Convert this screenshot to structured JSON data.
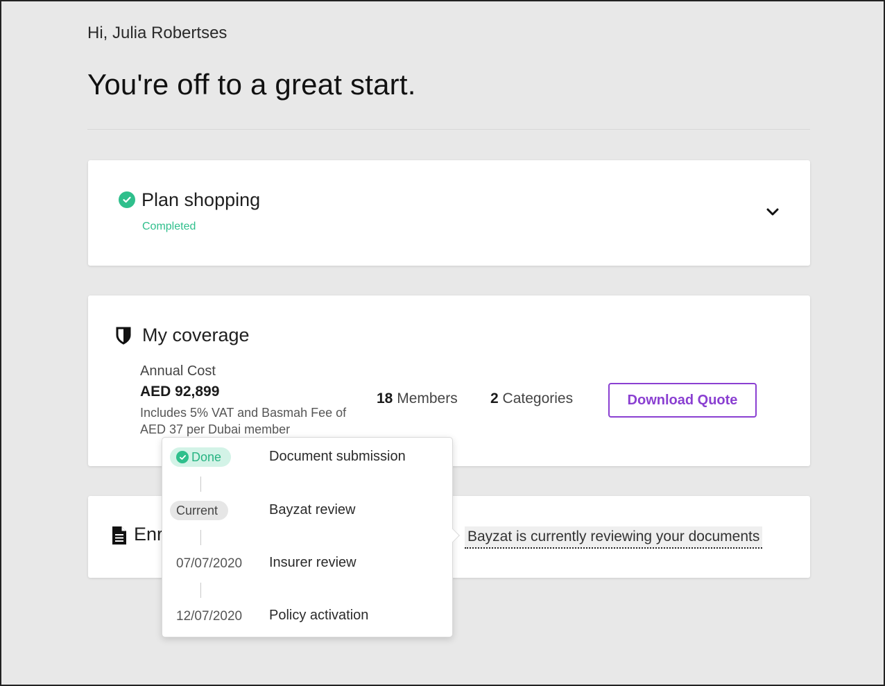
{
  "header": {
    "greeting": "Hi, Julia Robertses",
    "headline": "You're off to a great start."
  },
  "plan_shopping": {
    "title": "Plan shopping",
    "status": "Completed"
  },
  "coverage": {
    "title": "My coverage",
    "cost_label": "Annual Cost",
    "cost_value": "AED 92,899",
    "cost_note": "Includes 5% VAT and Basmah Fee of AED 37 per Dubai member",
    "members_count": "18",
    "members_label": "Members",
    "categories_count": "2",
    "categories_label": "Categories",
    "download_label": "Download Quote"
  },
  "enrollment": {
    "title_visible": "Enr",
    "status_text": "Bayzat is currently reviewing your documents"
  },
  "timeline": {
    "steps": [
      {
        "badge": "Done",
        "label": "Document submission"
      },
      {
        "badge": "Current",
        "label": "Bayzat review"
      },
      {
        "date": "07/07/2020",
        "label": "Insurer review"
      },
      {
        "date": "12/07/2020",
        "label": "Policy activation"
      }
    ]
  },
  "colors": {
    "accent_purple": "#8a3fd1",
    "success_green": "#2fbf8c",
    "background": "#e8e8e8"
  },
  "icons": [
    "check-circle-icon",
    "chevron-down-icon",
    "shield-icon",
    "document-icon"
  ]
}
